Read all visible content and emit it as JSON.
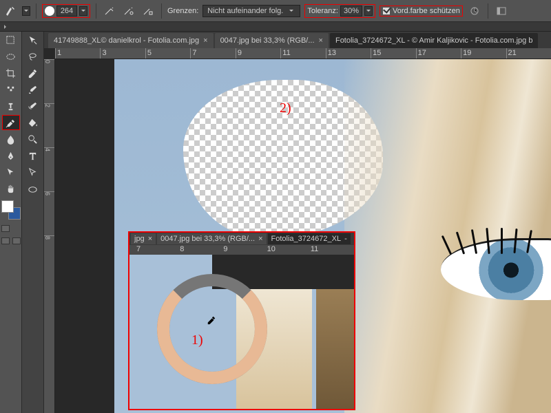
{
  "optionsBar": {
    "brushSize": "264",
    "limitsLabel": "Grenzen:",
    "limitsValue": "Nicht aufeinander folg.",
    "toleranceLabel": "Toleranz:",
    "toleranceValue": "30%",
    "protectForeground": "Vord.farbe schützen"
  },
  "tabs": [
    {
      "label": "41749888_XL© danielkrol - Fotolia.com.jpg",
      "active": false
    },
    {
      "label": "0047.jpg bei 33,3% (RGB/...",
      "active": false
    },
    {
      "label": "Fotolia_3724672_XL - © Amir Kaljikovic - Fotolia.com.jpg b",
      "active": true
    }
  ],
  "ruler": {
    "marks": [
      "1",
      "3",
      "5",
      "7",
      "9",
      "11",
      "13",
      "15",
      "17",
      "19",
      "21"
    ],
    "vmarks": [
      "0",
      "2",
      "4",
      "6",
      "8"
    ]
  },
  "inset": {
    "tabs": [
      {
        "label": "jpg",
        "active": false
      },
      {
        "label": "0047.jpg bei 33,3% (RGB/...",
        "active": false
      },
      {
        "label": "Fotolia_3724672_XL",
        "active": true
      }
    ],
    "ruler": [
      "7",
      "8",
      "9",
      "10",
      "11"
    ],
    "annotation": "1)"
  },
  "annotations": {
    "erase": "2)"
  },
  "tools": {
    "left": [
      "move",
      "rect-marquee",
      "crop",
      "magic-wand",
      "brush",
      "blur",
      "bg-eraser",
      "gradient",
      "pen",
      "arrow",
      "hand",
      "zoom"
    ],
    "right": [
      "arrow-select",
      "lasso",
      "eyedropper",
      "heal",
      "clone",
      "eraser",
      "paint-bucket",
      "magnify",
      "type",
      "path",
      "rotate",
      "shape"
    ]
  },
  "swatch": {
    "fg": "#ffffff",
    "bg": "#2b5a9e"
  }
}
